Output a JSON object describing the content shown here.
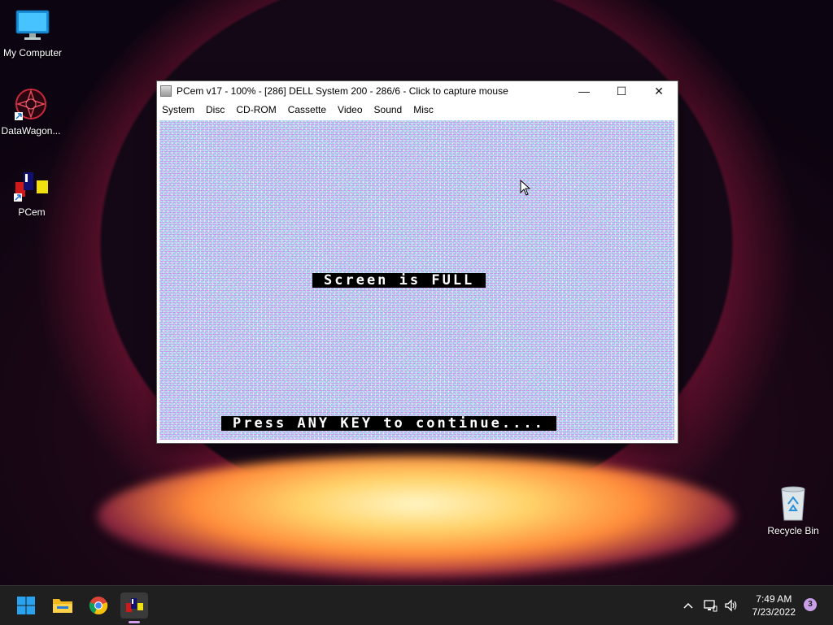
{
  "desktop": {
    "icons": [
      {
        "label": "My Computer"
      },
      {
        "label": "DataWagon..."
      },
      {
        "label": "PCem"
      },
      {
        "label": "Recycle Bin"
      }
    ]
  },
  "window": {
    "title": "PCem v17 - 100% - [286] DELL System 200 - 286/6 - Click to capture mouse",
    "menu": [
      "System",
      "Disc",
      "CD-ROM",
      "Cassette",
      "Video",
      "Sound",
      "Misc"
    ],
    "controls": {
      "minimize": "—",
      "maximize": "☐",
      "close": "✕"
    }
  },
  "emulator": {
    "message": "Screen is FULL",
    "prompt": "Press ANY KEY to continue...."
  },
  "taskbar": {
    "time": "7:49 AM",
    "date": "7/23/2022",
    "notifications": "3",
    "apps": [
      {
        "name": "start-button"
      },
      {
        "name": "file-explorer"
      },
      {
        "name": "chrome"
      },
      {
        "name": "pcem"
      }
    ]
  },
  "colors": {
    "accent_blue": "#29a3f0",
    "taskbar": "#1f1f1f"
  }
}
